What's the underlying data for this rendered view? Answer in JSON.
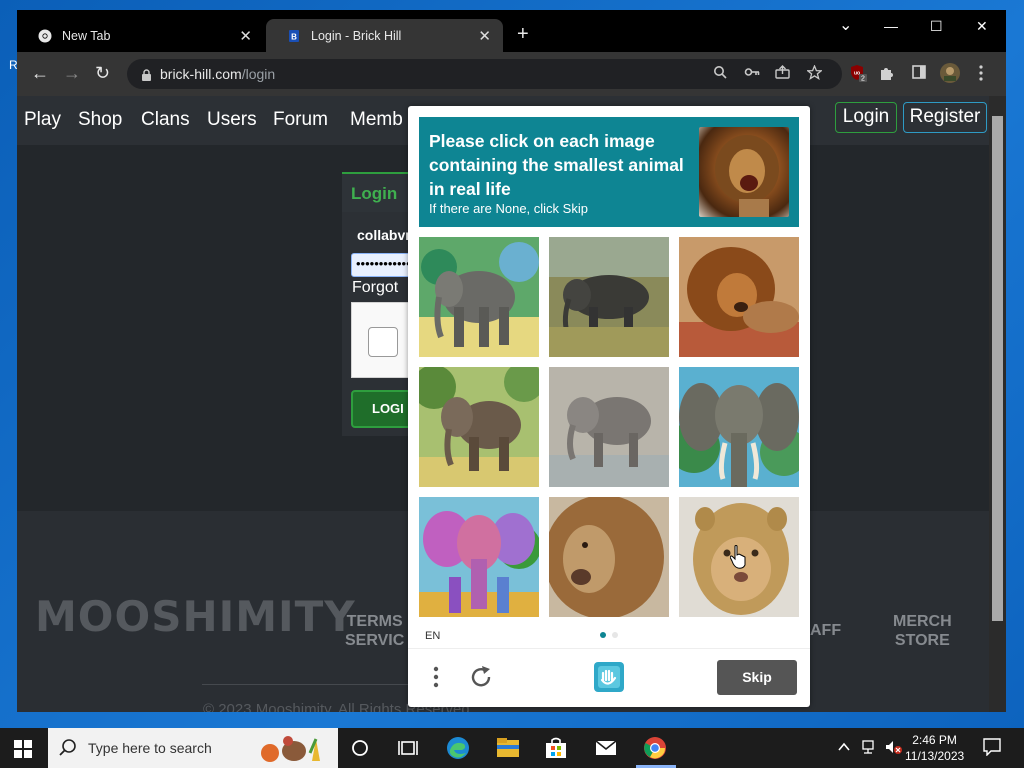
{
  "desktop": {
    "edge_text": "R"
  },
  "browser": {
    "tabs": [
      {
        "label": "New Tab",
        "close": "✕"
      },
      {
        "label": "Login - Brick Hill",
        "close": "✕"
      }
    ],
    "new_tab": "+",
    "window_controls": {
      "minimize": "—",
      "maximize": "☐",
      "close": "✕",
      "dropdown": "⌄"
    },
    "nav": {
      "back": "←",
      "forward": "→",
      "reload": "↻"
    },
    "url": {
      "host": "brick-hill.com",
      "path": "/login"
    }
  },
  "site": {
    "nav": [
      "Play",
      "Shop",
      "Clans",
      "Users",
      "Forum",
      "Memb"
    ],
    "login_button": "Login",
    "register_button": "Register",
    "login_panel": {
      "heading": "Login",
      "username": "collabvr",
      "password": "••••••••••••",
      "forgot": "Forgot",
      "submit": "LOGI"
    },
    "footer": {
      "brand": "MOOSHIMITY",
      "terms": [
        "TERMS",
        "SERVIC"
      ],
      "staff": "AFF",
      "merch": [
        "MERCH",
        "STORE"
      ],
      "copyright": "© 2023 Mooshimity. All Rights Reserved"
    }
  },
  "captcha": {
    "prompt": "Please click on each image containing the smallest animal in real life",
    "sub_prompt": "If there are None, click Skip",
    "language": "EN",
    "skip": "Skip",
    "accent": "#0e8593",
    "images": [
      {
        "subject": "elephant-painting"
      },
      {
        "subject": "elephant-photo"
      },
      {
        "subject": "lion-photo"
      },
      {
        "subject": "elephant-painting"
      },
      {
        "subject": "elephant-photo"
      },
      {
        "subject": "elephant-painting"
      },
      {
        "subject": "elephant-painting-colorful"
      },
      {
        "subject": "lion-photo"
      },
      {
        "subject": "lioness-photo"
      }
    ]
  },
  "taskbar": {
    "search_placeholder": "Type here to search",
    "time": "2:46 PM",
    "date": "11/13/2023"
  }
}
